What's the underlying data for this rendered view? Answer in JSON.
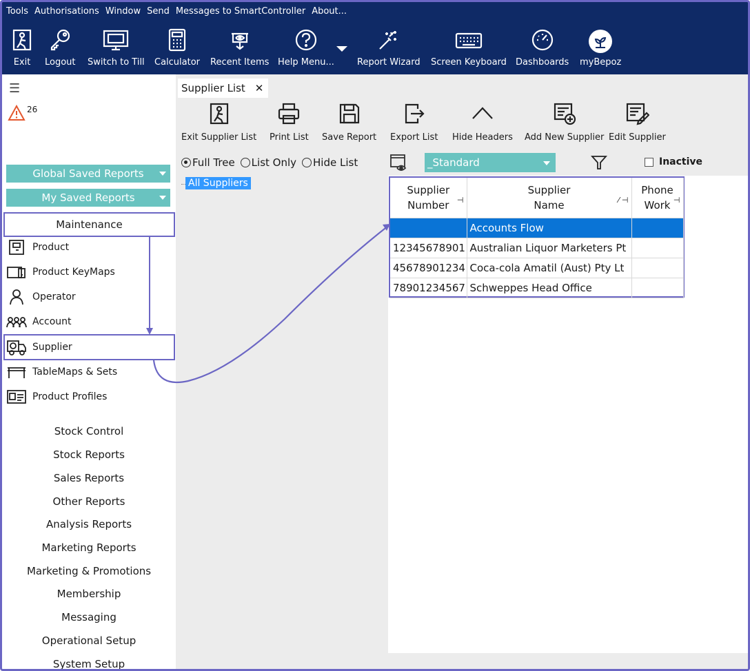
{
  "menu": [
    "Tools",
    "Authorisations",
    "Window",
    "Send",
    "Messages to SmartController",
    "About..."
  ],
  "toolbar": {
    "exit": "Exit",
    "logout": "Logout",
    "switch_to_till": "Switch to Till",
    "calculator": "Calculator",
    "recent_items": "Recent Items",
    "help_menu": "Help Menu...",
    "report_wizard": "Report Wizard",
    "screen_keyboard": "Screen Keyboard",
    "dashboards": "Dashboards",
    "mybepoz": "myBepoz"
  },
  "sidebar": {
    "alert_count": "26",
    "global_saved_reports": "Global Saved Reports",
    "my_saved_reports": "My Saved Reports",
    "maintenance": "Maintenance",
    "items": {
      "product": "Product",
      "product_keymaps": "Product KeyMaps",
      "operator": "Operator",
      "account": "Account",
      "supplier": "Supplier",
      "tablemaps": "TableMaps & Sets",
      "product_profiles": "Product Profiles"
    },
    "sections": {
      "stock_control": "Stock Control",
      "stock_reports": "Stock Reports",
      "sales_reports": "Sales Reports",
      "other_reports": "Other Reports",
      "analysis_reports": "Analysis Reports",
      "marketing_reports": "Marketing Reports",
      "marketing_promotions": "Marketing & Promotions",
      "membership": "Membership",
      "messaging": "Messaging",
      "operational_setup": "Operational Setup",
      "system_setup": "System Setup"
    }
  },
  "tab": {
    "label": "Supplier List",
    "close": "✕"
  },
  "actions": {
    "exit_supplier_list": "Exit Supplier List",
    "print_list": "Print List",
    "save_report": "Save Report",
    "export_list": "Export List",
    "hide_headers": "Hide Headers",
    "add_new_supplier": "Add New Supplier",
    "edit_supplier": "Edit Supplier"
  },
  "view_options": {
    "full_tree": "Full Tree",
    "list_only": "List Only",
    "hide_list": "Hide List"
  },
  "tree": {
    "selected": "All Suppliers"
  },
  "layout_select": {
    "value": "_Standard"
  },
  "inactive_label": "Inactive",
  "grid": {
    "columns": {
      "number_line1": "Supplier",
      "number_line2": "Number",
      "name_line1": "Supplier",
      "name_line2": "Name",
      "phone_line1": "Phone",
      "phone_line2": "Work"
    },
    "rows": [
      {
        "number": "",
        "name": "Accounts Flow",
        "phone": ""
      },
      {
        "number": "12345678901",
        "name": "Australian Liquor Marketers Pt",
        "phone": ""
      },
      {
        "number": "45678901234",
        "name": "Coca-cola Amatil (Aust) Pty Lt",
        "phone": ""
      },
      {
        "number": "78901234567",
        "name": "Schweppes Head Office",
        "phone": ""
      }
    ]
  },
  "colors": {
    "nav_bg": "#0f2a66",
    "teal": "#69c3c0",
    "highlight": "#6b66c4",
    "selected_row": "#0a74d6"
  }
}
